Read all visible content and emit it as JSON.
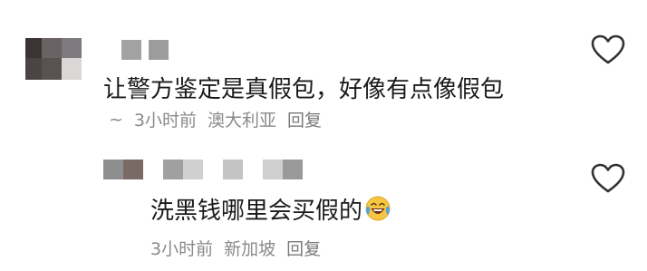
{
  "comments": [
    {
      "text": "让警方鉴定是真假包，好像有点像假包",
      "prefix": "~",
      "time": "3小时前",
      "location": "澳大利亚",
      "reply_label": "回复",
      "icon": "heart-outline-icon"
    },
    {
      "text": "洗黑钱哪里会买假的",
      "emoji": "laughing-tears-emoji",
      "time": "3小时前",
      "location": "新加坡",
      "reply_label": "回复",
      "icon": "heart-outline-icon"
    }
  ],
  "colors": {
    "text": "#1a1a1a",
    "meta": "#8a8a8a",
    "heart": "#333333"
  }
}
